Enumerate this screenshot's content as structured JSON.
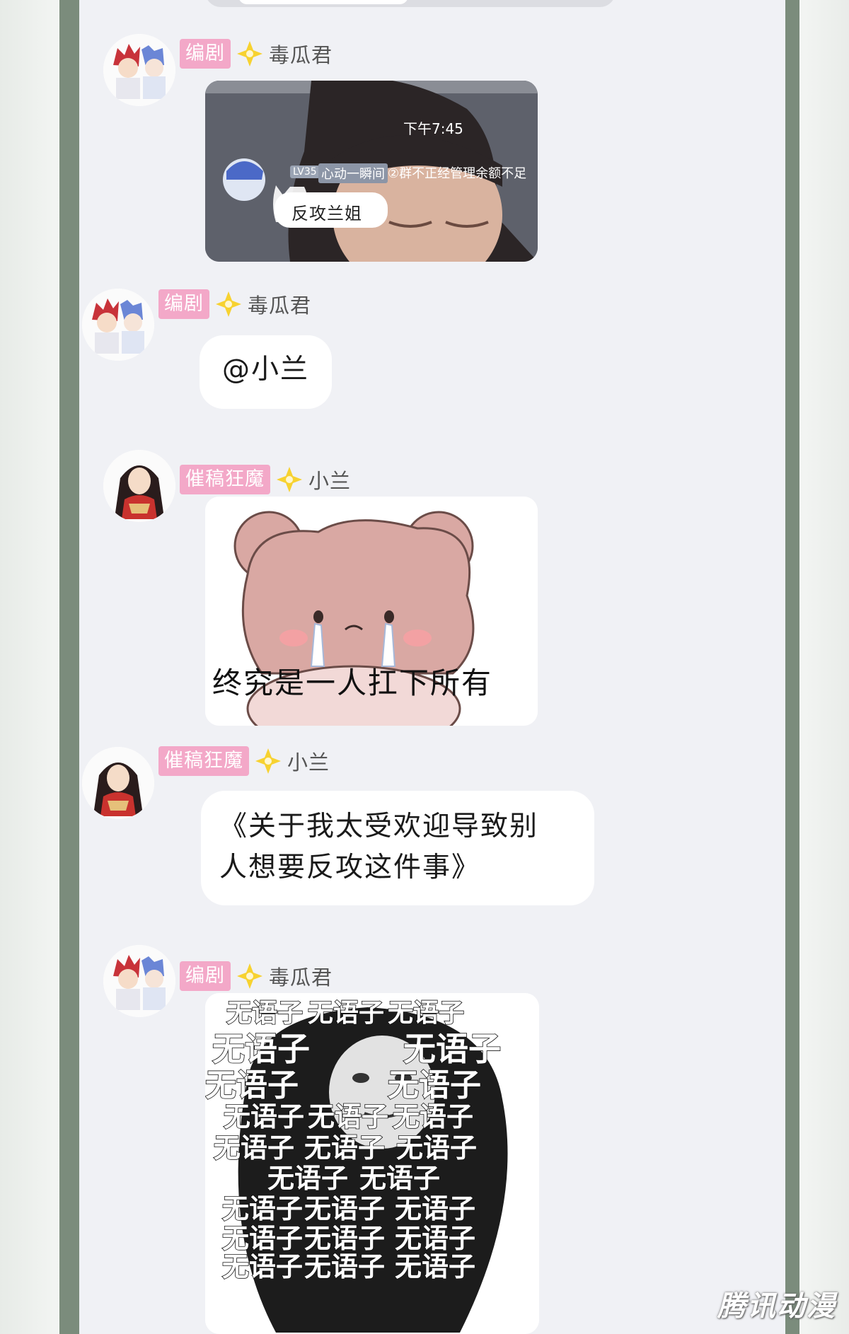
{
  "messages": [
    {
      "role": "编剧",
      "name": "毒瓜君",
      "type": "image",
      "screenshot": {
        "time": "下午7:45",
        "level": "LV35",
        "nick": "心动一瞬间",
        "text": "②群不正经管理余额不足",
        "sticker_text": "反攻兰姐"
      }
    },
    {
      "role": "编剧",
      "name": "毒瓜君",
      "type": "text",
      "text": "@小兰"
    },
    {
      "role": "催稿狂魔",
      "name": "小兰",
      "type": "sticker",
      "caption": "终究是一人扛下所有"
    },
    {
      "role": "催稿狂魔",
      "name": "小兰",
      "type": "text",
      "lines": [
        "《关于我太受欢迎导致别",
        "人想要反攻这件事》"
      ]
    },
    {
      "role": "编剧",
      "name": "毒瓜君",
      "type": "sticker",
      "word": "无语子"
    }
  ],
  "watermark": "腾讯动漫",
  "colors": {
    "badge": "#f3a8c8",
    "star": "#f7d230",
    "frame": "#7b8c7c",
    "panel": "#f0f1f5"
  }
}
